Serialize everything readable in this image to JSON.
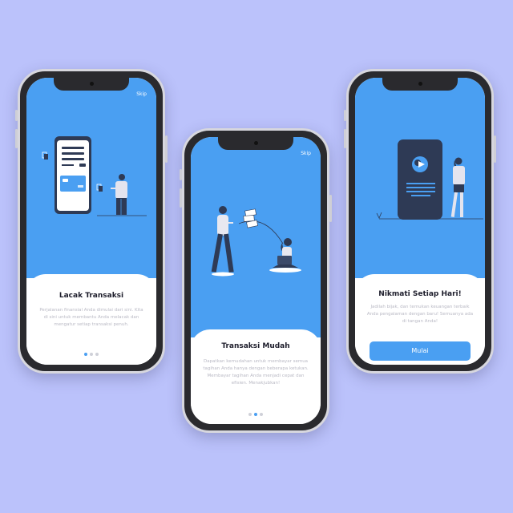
{
  "screens": [
    {
      "skip_label": "Skip",
      "title": "Lacak Transaksi",
      "description": "Perjalanan finansial Anda dimulai dari sini. Kita di sini untuk membantu Anda melacak dan mengatur setiap transaksi penuh.",
      "active_dot": 0
    },
    {
      "skip_label": "Skip",
      "title": "Transaksi Mudah",
      "description": "Dapatkan kemudahan untuk membayar semua tagihan Anda hanya dengan beberapa ketukan. Membayar tagihan Anda menjadi cepat dan efisien. Menakjubkan!",
      "active_dot": 1
    },
    {
      "title": "Nikmati Setiap Hari!",
      "description": "Jadilah bijak, dan temukan keuangan terbaik Anda pengalaman dengan baru! Semuanya ada di tangan Anda!",
      "button_label": "Mulai",
      "active_dot": 2
    }
  ],
  "colors": {
    "background": "#bbc2fb",
    "accent": "#4a9ff2",
    "phone_frame": "#2a2a2e",
    "text_dark": "#1d1d2b",
    "text_muted": "#b9b9c4"
  },
  "icons": [
    "phone-illustration",
    "person-illustration",
    "banknote-icon",
    "laptop-icon"
  ]
}
